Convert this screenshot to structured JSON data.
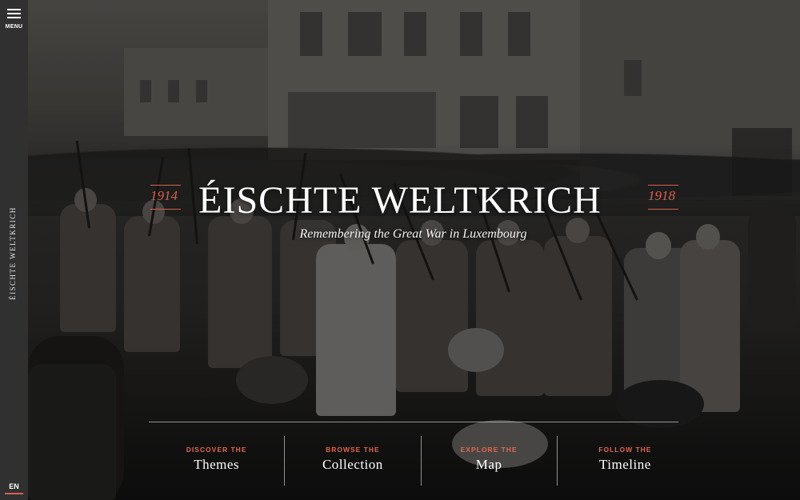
{
  "sidebar": {
    "menu_label": "MENU",
    "vertical_title": "ÉISCHTE WELTKRICH",
    "language": "EN"
  },
  "hero": {
    "title": "ÉISCHTE WELTKRICH",
    "year_start": "1914",
    "year_end": "1918",
    "subtitle": "Remembering the Great War in Luxembourg"
  },
  "nav": [
    {
      "kicker": "DISCOVER THE",
      "label": "Themes"
    },
    {
      "kicker": "BROWSE THE",
      "label": "Collection"
    },
    {
      "kicker": "EXPLORE THE",
      "label": "Map"
    },
    {
      "kicker": "FOLLOW THE",
      "label": "Timeline"
    }
  ],
  "colors": {
    "accent": "#d9604c",
    "sidebar": "#303030"
  }
}
